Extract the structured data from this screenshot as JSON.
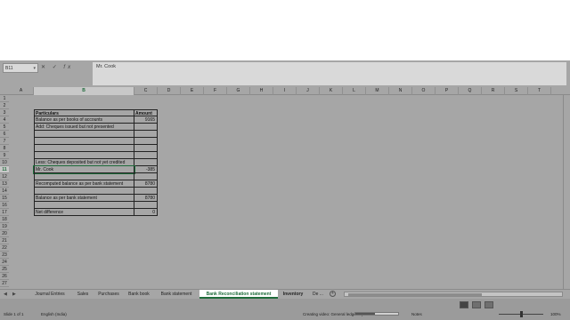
{
  "formula_bar": {
    "name_box": "B11",
    "cancel": "✕",
    "enter": "✓",
    "fx": "fx",
    "content": "Mr. Cook"
  },
  "columns": [
    "A",
    "B",
    "C",
    "D",
    "E",
    "F",
    "G",
    "H",
    "I",
    "J",
    "K",
    "L",
    "M",
    "N",
    "O",
    "P",
    "Q",
    "R",
    "S",
    "T"
  ],
  "rows": [
    "1",
    "2",
    "3",
    "4",
    "5",
    "6",
    "7",
    "8",
    "9",
    "10",
    "11",
    "12",
    "13",
    "14",
    "15",
    "16",
    "17",
    "18",
    "19",
    "20",
    "21",
    "22",
    "23",
    "24",
    "25",
    "26",
    "27"
  ],
  "selected": {
    "column": "B",
    "row": "11"
  },
  "sheet": {
    "header_particulars": "Particulars",
    "header_amount": "Amount",
    "r4_label": "Balance as per books of accounts",
    "r4_value": "9165",
    "r5_label": "Add: Cheques issued but not presented",
    "r10_label": "Less: Cheques deposited but not yet credited",
    "r11_label": "Mr. Cook",
    "r11_value": "-385",
    "r13_label": "Recomputed balance as per bank statement",
    "r13_value": "8780",
    "r15_label": "Balance as per bank statement",
    "r15_value": "8780",
    "r17_label": "Net difference",
    "r17_value": "0"
  },
  "tabs": [
    "Journal Entries",
    "Sales",
    "Purchases",
    "Bank book",
    "Bank statement",
    "Bank Reconciliation statement",
    "Inventory",
    "De ..."
  ],
  "active_tab": "Bank Reconciliation statement",
  "tab_nav": {
    "prev": "◀",
    "next": "▶",
    "add": "+"
  },
  "status": {
    "page": "Slide 1 of 1",
    "language": "English (India)",
    "task": "Creating video: General ledger.mp4",
    "progress": 0.45,
    "notes": "Notes",
    "zoom": "100%"
  },
  "colors": {
    "accent": "#1e6b3a",
    "chrome": "#a6a6a6",
    "status": "#9b9b9b"
  }
}
